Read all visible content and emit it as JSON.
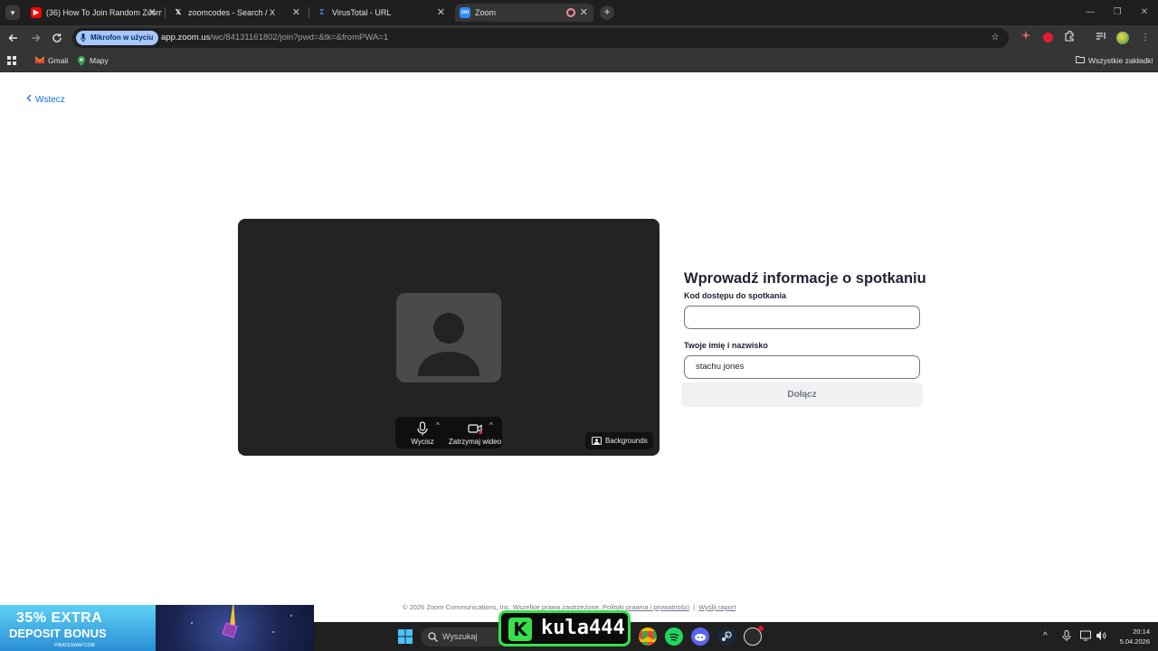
{
  "browser": {
    "tabs": [
      {
        "title": "(36) How To Join Random Zoom",
        "favicon": "youtube-icon",
        "active": false
      },
      {
        "title": "zoomcodes - Search / X",
        "favicon": "x-icon",
        "active": false
      },
      {
        "title": "VirusTotal - URL",
        "favicon": "virustotal-icon",
        "active": false
      },
      {
        "title": "Zoom",
        "favicon": "zoom-icon",
        "active": true
      }
    ],
    "mic_in_use_label": "Mikrofon w użyciu",
    "url_host": "app.zoom.us",
    "url_path": "/wc/84131161802/join?pwd=&tk=&fromPWA=1",
    "bookmarks": [
      {
        "label": "Gmail",
        "icon": "gmail-icon"
      },
      {
        "label": "Mapy",
        "icon": "maps-icon"
      }
    ],
    "all_bookmarks_label": "Wszystkie zakładki"
  },
  "page": {
    "back_label": "Wstecz",
    "controls": {
      "mute_label": "Wycisz",
      "stop_video_label": "Zatrzymaj wideo",
      "backgrounds_label": "Backgrounds"
    },
    "form": {
      "title": "Wprowadź informacje o spotkaniu",
      "passcode_label": "Kod dostępu do spotkania",
      "passcode_value": "",
      "name_label": "Twoje imię i nazwisko",
      "name_value": "stachu jones",
      "join_label": "Dołącz"
    },
    "footer": {
      "copyright": "© 2026 Zoom Communications, Inc. Wszelkie prawa zastrzeżone.",
      "legal_link": "Polityki prawna i prywatności",
      "separator": "|",
      "report_link": "Wyślij raport"
    }
  },
  "overlay": {
    "ad_line1": "35% EXTRA",
    "ad_line2": "DEPOSIT BONUS",
    "ad_line3": "PIRATESWAP.COM",
    "streamer_name": "kula444"
  },
  "taskbar": {
    "search_placeholder": "Wyszukaj",
    "time": "20:14",
    "date": "5.04.2026"
  },
  "colors": {
    "zoom_blue": "#0e72ed",
    "chrome_dark": "#1f1f1f",
    "toolbar": "#353535",
    "preview_bg": "#232323",
    "kula_green": "#36e04a"
  }
}
